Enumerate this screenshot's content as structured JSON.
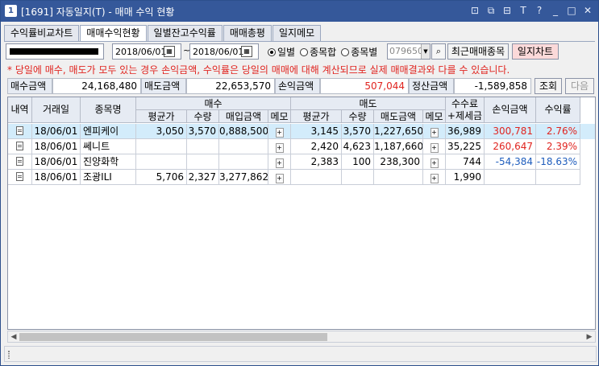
{
  "window": {
    "number": "1",
    "title": "[1691] 자동일지(T) - 매매 수익 현황",
    "icons": [
      "restore-icon",
      "copy-icon",
      "tile-icon",
      "font-icon",
      "help-icon",
      "minimize-icon",
      "maximize-icon",
      "close-icon"
    ]
  },
  "tabs": [
    {
      "label": "수익률비교차트",
      "active": false
    },
    {
      "label": "매매수익현황",
      "active": true
    },
    {
      "label": "일별잔고수익률",
      "active": false
    },
    {
      "label": "매매총평",
      "active": false
    },
    {
      "label": "일지메모",
      "active": false
    }
  ],
  "toolbar": {
    "date_from": "2018/06/01",
    "tilde": "~",
    "date_to": "2018/06/01",
    "radios": [
      {
        "label": "일별",
        "checked": true
      },
      {
        "label": "종목합",
        "checked": false
      },
      {
        "label": "종목별",
        "checked": false
      }
    ],
    "stock_code": "079650",
    "recent_label": "최근매매종목",
    "chart_label": "일지차트"
  },
  "notice": "* 당일에 매수, 매도가 모두 있는 경우 손익금액, 수익률은 당일의 매매에 대해 계산되므로 실제 매매결과와 다를 수 있습니다.",
  "summary": {
    "buy_label": "매수금액",
    "buy_value": "24,168,480",
    "sell_label": "매도금액",
    "sell_value": "22,653,570",
    "pl_label": "손익금액",
    "pl_value": "507,044",
    "settle_label": "정산금액",
    "settle_value": "-1,589,858",
    "query_label": "조회",
    "next_label": "다음"
  },
  "table": {
    "headers": {
      "detail": "내역",
      "date": "거래일",
      "name": "종목명",
      "buy_group": "매수",
      "sell_group": "매도",
      "avg": "평균가",
      "qty": "수량",
      "buy_amt": "매입금액",
      "memo": "메모",
      "sell_amt": "매도금액",
      "fee": "수수료\n+제세금",
      "fee_top": "수수료",
      "fee_bottom": "+제세금",
      "pl": "손익금액",
      "rate": "수익률"
    },
    "rows": [
      {
        "date": "18/06/01",
        "name": "엔피케이",
        "b_avg": "3,050",
        "b_qty": "3,570",
        "b_amt": "0,888,500",
        "b_memo": true,
        "s_avg": "3,145",
        "s_qty": "3,570",
        "s_amt": "1,227,650",
        "s_memo": true,
        "fee": "36,989",
        "pl": "300,781",
        "rate": "2.76%",
        "sign": "pos",
        "selected": true
      },
      {
        "date": "18/06/01",
        "name": "쎄니트",
        "b_avg": "",
        "b_qty": "",
        "b_amt": "",
        "b_memo": true,
        "s_avg": "2,420",
        "s_qty": "4,623",
        "s_amt": "1,187,660",
        "s_memo": true,
        "fee": "35,225",
        "pl": "260,647",
        "rate": "2.39%",
        "sign": "pos",
        "selected": false
      },
      {
        "date": "18/06/01",
        "name": "진양화학",
        "b_avg": "",
        "b_qty": "",
        "b_amt": "",
        "b_memo": true,
        "s_avg": "2,383",
        "s_qty": "100",
        "s_amt": "238,300",
        "s_memo": true,
        "fee": "744",
        "pl": "-54,384",
        "rate": "-18.63%",
        "sign": "neg",
        "selected": false
      },
      {
        "date": "18/06/01",
        "name": "조광ILI",
        "b_avg": "5,706",
        "b_qty": "2,327",
        "b_amt": "3,277,862",
        "b_memo": true,
        "s_avg": "",
        "s_qty": "",
        "s_amt": "",
        "s_memo": true,
        "fee": "1,990",
        "pl": "",
        "rate": "",
        "sign": "none",
        "selected": false
      }
    ]
  },
  "colors": {
    "title_bar": "#35589a",
    "positive": "#e0241f",
    "negative": "#1f5dbd",
    "selected_row": "#d3ecfb"
  }
}
